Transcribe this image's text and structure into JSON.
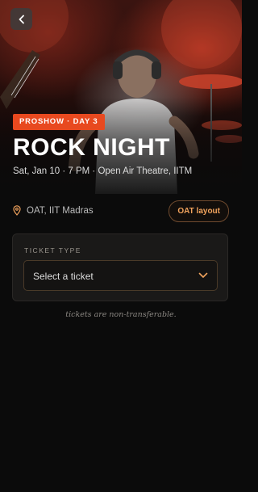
{
  "event": {
    "badge": "PROSHOW · DAY 3",
    "title": "ROCK NIGHT",
    "subtitle": "Sat, Jan 10 · 7 PM · Open Air Theatre, IITM"
  },
  "venue": {
    "name": "OAT, IIT Madras",
    "layout_button": "OAT layout"
  },
  "ticket": {
    "section_label": "TICKET TYPE",
    "select_placeholder": "Select a ticket"
  },
  "note": "tickets are non-transferable.",
  "icons": {
    "back": "chevron-left-icon",
    "location": "map-pin-icon",
    "dropdown": "chevron-down-icon"
  },
  "colors": {
    "accent": "#e8491f",
    "layout_text": "#f1a35d",
    "background": "#0b0b0b"
  }
}
